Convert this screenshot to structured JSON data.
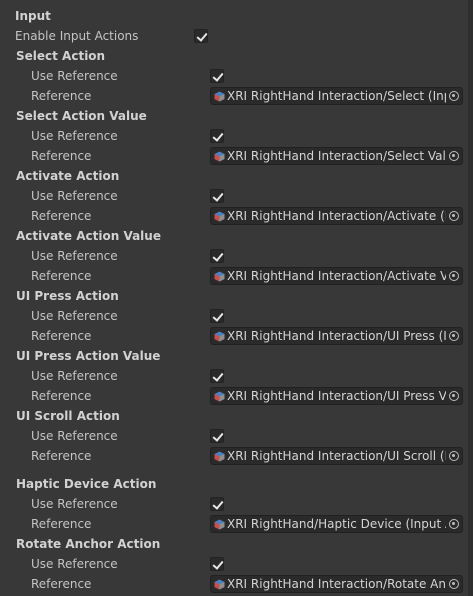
{
  "inspector": {
    "header": "Input",
    "enable_input_actions": {
      "label": "Enable Input Actions",
      "checked": true
    },
    "groups": [
      {
        "title": "Select Action",
        "use_reference_label": "Use Reference",
        "use_reference_checked": true,
        "reference_label": "Reference",
        "reference_value": "XRI RightHand Interaction/Select (Input Action Reference)"
      },
      {
        "title": "Select Action Value",
        "use_reference_label": "Use Reference",
        "use_reference_checked": true,
        "reference_label": "Reference",
        "reference_value": "XRI RightHand Interaction/Select Value (Input Action Reference)"
      },
      {
        "title": "Activate Action",
        "use_reference_label": "Use Reference",
        "use_reference_checked": true,
        "reference_label": "Reference",
        "reference_value": "XRI RightHand Interaction/Activate (Input Action Reference)"
      },
      {
        "title": "Activate Action Value",
        "use_reference_label": "Use Reference",
        "use_reference_checked": true,
        "reference_label": "Reference",
        "reference_value": "XRI RightHand Interaction/Activate Value (Input Action Reference)"
      },
      {
        "title": "UI Press Action",
        "use_reference_label": "Use Reference",
        "use_reference_checked": true,
        "reference_label": "Reference",
        "reference_value": "XRI RightHand Interaction/UI Press (Input Action Reference)"
      },
      {
        "title": "UI Press Action Value",
        "use_reference_label": "Use Reference",
        "use_reference_checked": true,
        "reference_label": "Reference",
        "reference_value": "XRI RightHand Interaction/UI Press Value (Input Action Reference)"
      },
      {
        "title": "UI Scroll Action",
        "use_reference_label": "Use Reference",
        "use_reference_checked": true,
        "reference_label": "Reference",
        "reference_value": "XRI RightHand Interaction/UI Scroll (Input Action Reference)"
      },
      {
        "title": "Haptic Device Action",
        "use_reference_label": "Use Reference",
        "use_reference_checked": true,
        "reference_label": "Reference",
        "reference_value": "XRI RightHand/Haptic Device (Input Action Reference)"
      },
      {
        "title": "Rotate Anchor Action",
        "use_reference_label": "Use Reference",
        "use_reference_checked": true,
        "reference_label": "Reference",
        "reference_value": "XRI RightHand Interaction/Rotate Anchor (Input Action Reference)"
      }
    ],
    "icons": {
      "reference_icon": "input-action-asset-icon",
      "picker_icon": "object-picker-icon"
    },
    "colors": {
      "background": "#383838",
      "field": "#2a2a2a",
      "text": "#c4c4c4",
      "icon_blue": "#5a8fd0",
      "icon_red": "#c8504a"
    }
  }
}
